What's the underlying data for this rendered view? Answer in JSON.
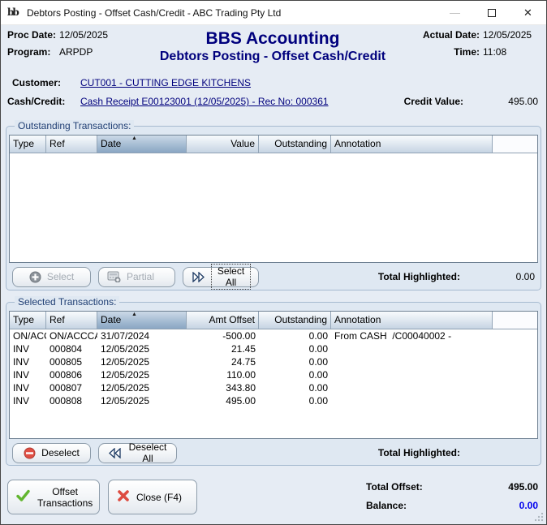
{
  "window": {
    "title": "Debtors Posting - Offset Cash/Credit - ABC Trading Pty Ltd",
    "icon_glyph": "bb"
  },
  "icons": {
    "minimize": "—",
    "close": "✕",
    "sort_asc": "▲"
  },
  "header": {
    "proc_date_label": "Proc Date:",
    "proc_date": "12/05/2025",
    "program_label": "Program:",
    "program": "ARPDP",
    "app_title": "BBS Accounting",
    "screen_title": "Debtors Posting - Offset Cash/Credit",
    "actual_date_label": "Actual Date:",
    "actual_date": "12/05/2025",
    "time_label": "Time:",
    "time": "11:08"
  },
  "info": {
    "customer_label": "Customer:",
    "customer_link": "CUT001 - CUTTING EDGE KITCHENS",
    "cash_credit_label": "Cash/Credit:",
    "cash_credit_link": "Cash Receipt E00123001 (12/05/2025) - Rec No: 000361",
    "credit_value_label": "Credit Value:",
    "credit_value": "495.00"
  },
  "outstanding": {
    "group_label": "Outstanding Transactions:",
    "columns": [
      "Type",
      "Ref",
      "Date",
      "Value",
      "Outstanding",
      "Annotation"
    ],
    "rows": [],
    "select_label": "Select",
    "partial_label": "Partial",
    "select_all_label": "Select All",
    "total_highlighted_label": "Total Highlighted:",
    "total_highlighted_value": "0.00"
  },
  "selected": {
    "group_label": "Selected Transactions:",
    "columns": [
      "Type",
      "Ref",
      "Date",
      "Amt Offset",
      "Outstanding",
      "Annotation"
    ],
    "rows": [
      {
        "type": "ON/ACC",
        "ref": "ON/ACCCA...",
        "date": "31/07/2024",
        "amt": "-500.00",
        "outstanding": "0.00",
        "annotation": "From CASH  /C00040002 -"
      },
      {
        "type": "INV",
        "ref": "000804",
        "date": "12/05/2025",
        "amt": "21.45",
        "outstanding": "0.00",
        "annotation": ""
      },
      {
        "type": "INV",
        "ref": "000805",
        "date": "12/05/2025",
        "amt": "24.75",
        "outstanding": "0.00",
        "annotation": ""
      },
      {
        "type": "INV",
        "ref": "000806",
        "date": "12/05/2025",
        "amt": "110.00",
        "outstanding": "0.00",
        "annotation": ""
      },
      {
        "type": "INV",
        "ref": "000807",
        "date": "12/05/2025",
        "amt": "343.80",
        "outstanding": "0.00",
        "annotation": ""
      },
      {
        "type": "INV",
        "ref": "000808",
        "date": "12/05/2025",
        "amt": "495.00",
        "outstanding": "0.00",
        "annotation": ""
      }
    ],
    "deselect_label": "Deselect",
    "deselect_all_label": "Deselect All",
    "total_highlighted_label": "Total Highlighted:",
    "total_highlighted_value": ""
  },
  "footer": {
    "offset_line1": "Offset",
    "offset_line2": "Transactions",
    "close_label": "Close (F4)",
    "total_offset_label": "Total Offset:",
    "total_offset_value": "495.00",
    "balance_label": "Balance:",
    "balance_value": "0.00"
  },
  "colors": {
    "navy": "#00007d",
    "link": "#00007d",
    "balance_blue": "#0000ee",
    "check_green": "#62b62f",
    "cross_red": "#dd4c41",
    "no_entry_red": "#e04f44"
  }
}
